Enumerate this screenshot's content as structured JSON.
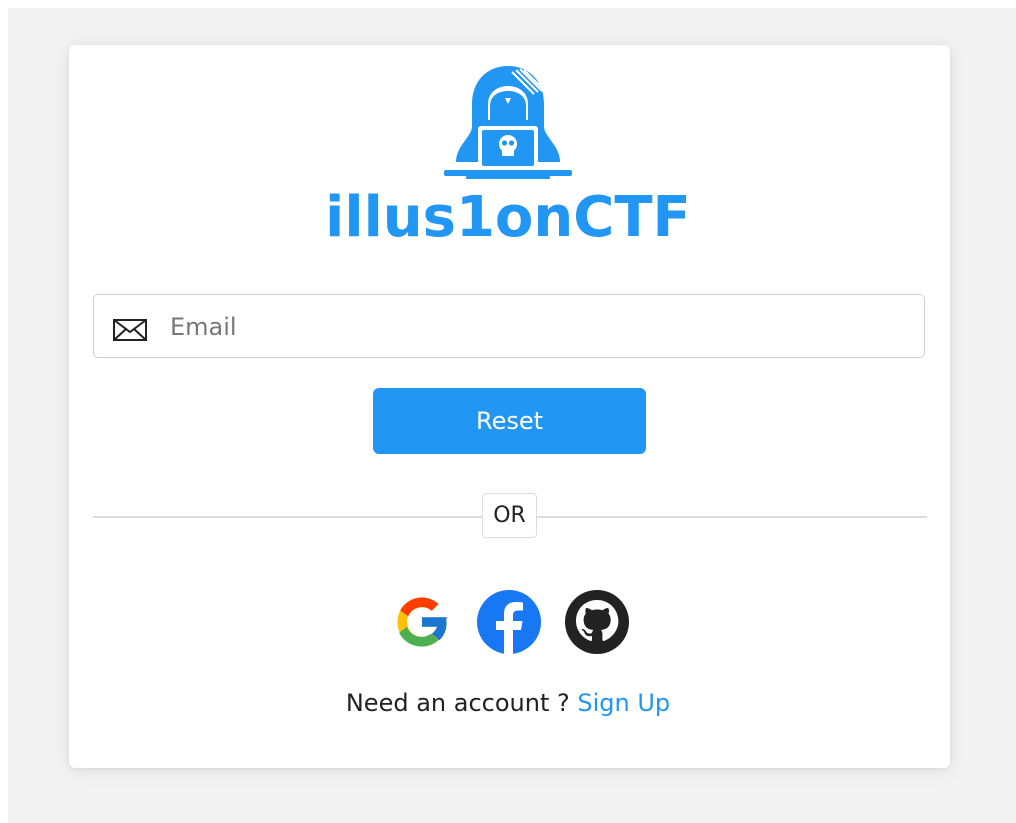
{
  "brand": {
    "name": "illus1onCTF",
    "color": "#2196f3",
    "logo_icon": "hacker-with-laptop-icon"
  },
  "form": {
    "email": {
      "icon": "envelope-icon",
      "placeholder": "Email",
      "value": ""
    },
    "reset_label": "Reset",
    "button_color": "#2196f3"
  },
  "divider": {
    "label": "OR"
  },
  "social": [
    {
      "name": "google-icon"
    },
    {
      "name": "facebook-icon",
      "color": "#1877f2"
    },
    {
      "name": "github-icon",
      "color": "#222222"
    }
  ],
  "footer": {
    "prompt": "Need an account ?",
    "link_label": "Sign Up",
    "link_color": "#2196f3"
  }
}
